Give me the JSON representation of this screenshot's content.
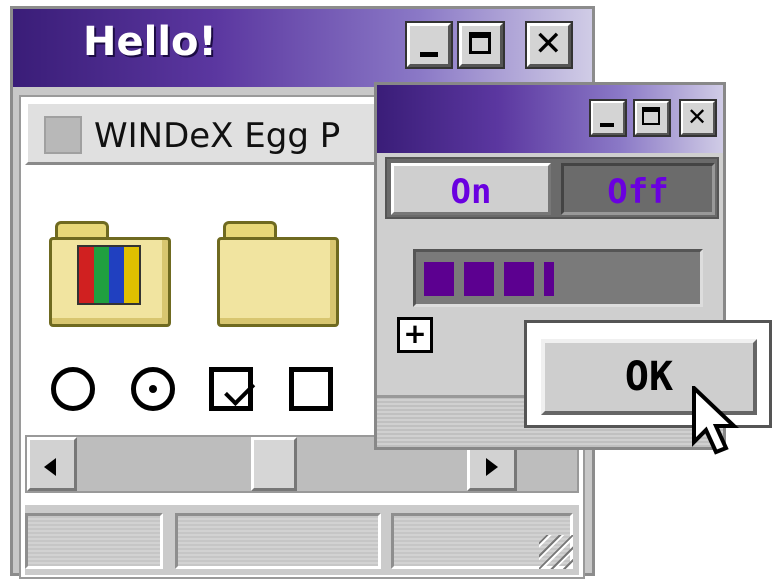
{
  "main_window": {
    "title": "Hello!",
    "path_text": "WINDeX Egg P",
    "controls": {
      "minimize": "_",
      "maximize": "□",
      "close": "X"
    }
  },
  "icons": [
    {
      "name": "folder-with-windows-logo-icon"
    },
    {
      "name": "folder-icon"
    }
  ],
  "controls": {
    "radio_unchecked": false,
    "radio_checked": true,
    "checkbox_checked": true,
    "checkbox_unchecked": false
  },
  "statusbar": {
    "cells": [
      "",
      "",
      ""
    ]
  },
  "secondary_window": {
    "tabs": [
      {
        "label": "On",
        "selected": true
      },
      {
        "label": "Off",
        "selected": false
      }
    ],
    "progress_blocks": 4,
    "plus_label": "+"
  },
  "dialog": {
    "ok_label": "OK"
  },
  "colors": {
    "title_gradient_start": "#3a1d78",
    "tab_text": "#6a00e0",
    "progress_fill": "#5c0090"
  }
}
